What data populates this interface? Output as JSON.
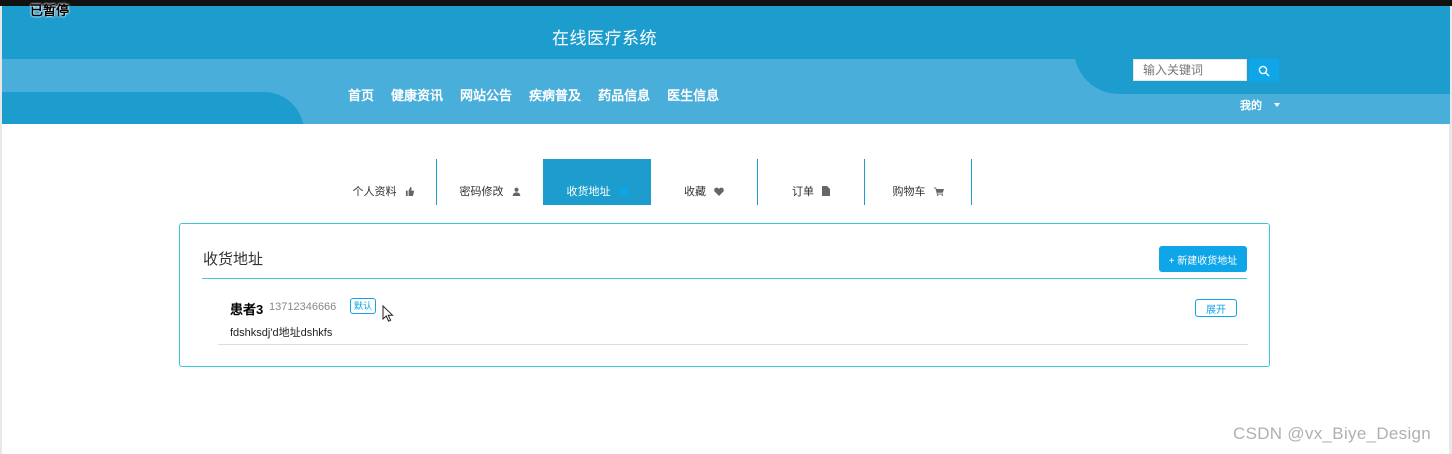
{
  "overlay": {
    "paused_label": "已暂停"
  },
  "header": {
    "site_title": "在线医疗系统",
    "nav": [
      "首页",
      "健康资讯",
      "网站公告",
      "疾病普及",
      "药品信息",
      "医生信息"
    ],
    "search_placeholder": "输入关键词",
    "user_menu": "我的"
  },
  "tabs": [
    {
      "label": "个人资料",
      "icon": "thumb-icon",
      "active": false
    },
    {
      "label": "密码修改",
      "icon": "user-icon",
      "active": false
    },
    {
      "label": "收货地址",
      "icon": "location-icon",
      "active": true
    },
    {
      "label": "收藏",
      "icon": "heart-icon",
      "active": false
    },
    {
      "label": "订单",
      "icon": "file-icon",
      "active": false
    },
    {
      "label": "购物车",
      "icon": "cart-icon",
      "active": false
    }
  ],
  "address_panel": {
    "title": "收货地址",
    "new_button": "+ 新建收货地址",
    "entries": [
      {
        "name": "患者3",
        "phone": "13712346666",
        "badge": "默认",
        "detail": "fdshksdj'd地址dshkfs",
        "expand_label": "展开"
      }
    ]
  },
  "watermark": "CSDN @vx_Biye_Design",
  "colors": {
    "primary": "#1d9dce",
    "accent": "#0ea5e9",
    "border": "#3ec7d8"
  }
}
